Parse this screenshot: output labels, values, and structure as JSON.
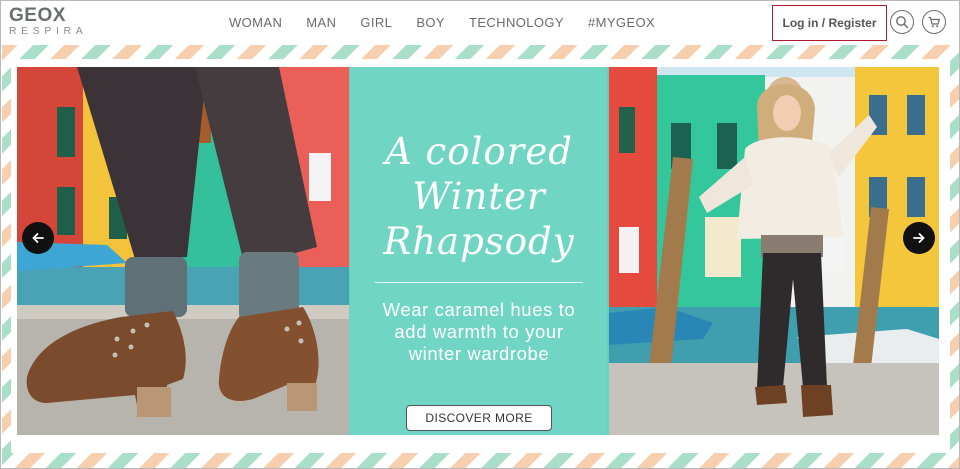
{
  "header": {
    "logo": {
      "main": "GEOX",
      "sub": "RESPIRA"
    },
    "nav": [
      {
        "label": "WOMAN"
      },
      {
        "label": "MAN"
      },
      {
        "label": "GIRL"
      },
      {
        "label": "BOY"
      },
      {
        "label": "TECHNOLOGY"
      },
      {
        "label": "#MYGEOX"
      }
    ],
    "login_label": "Log in / Register",
    "icons": {
      "search": "search-icon",
      "cart": "shopping-cart-icon"
    }
  },
  "hero": {
    "headline": [
      "A colored",
      "Winter",
      "Rhapsody"
    ],
    "subline": [
      "Wear caramel hues to",
      "add warmth to your",
      "winter wardrobe"
    ],
    "cta_label": "DISCOVER MORE",
    "prev_icon": "arrow-left-icon",
    "next_icon": "arrow-right-icon"
  },
  "colors": {
    "panel_teal": "#66d2c0",
    "border_peach": "#f7cfae",
    "border_mint": "#a9dfc9",
    "login_border": "#b2182b"
  }
}
